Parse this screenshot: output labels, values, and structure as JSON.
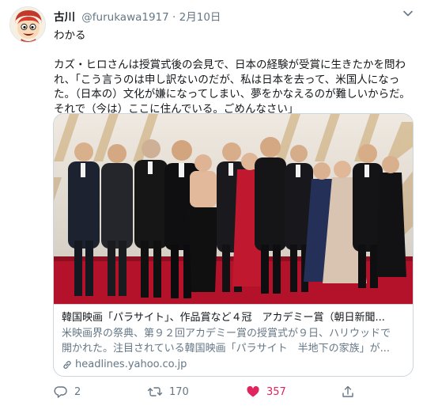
{
  "tweet": {
    "author_name": "古川",
    "author_handle": "@furukawa1917",
    "separator": "·",
    "date": "2月10日",
    "text": "わかる\n\nカズ・ヒロさんは授賞式後の会見で、日本の経験が受賞に生きたかを問われ、「こう言うのは申し訳ないのだが、私は日本を去って、米国人になった。（日本の）文化が嫌になってしまい、夢をかなえるのが難しいからだ。それで（今は）ここに住んでいる。ごめんなさい」"
  },
  "card": {
    "title": "韓国映画「パラサイト」、作品賞など４冠　アカデミー賞（朝日新聞...",
    "description_line1": "米映画界の祭典、第９２回アカデミー賞の授賞式が９日、ハリウッドで",
    "description_line2": "開かれた。注目されている韓国映画「パラサイト　半地下の家族」が...",
    "domain": "headlines.yahoo.co.jp",
    "photo_desc": "group-photo"
  },
  "actions": {
    "reply_count": "2",
    "retweet_count": "170",
    "like_count": "357"
  },
  "colors": {
    "text": "#14171a",
    "secondary": "#657786",
    "like": "#e0245e",
    "border": "#ccd6dd",
    "carpet": "#b3122a"
  },
  "icons": [
    "avatar-character",
    "chevron-down-icon",
    "reply-icon",
    "retweet-icon",
    "heart-icon",
    "share-icon",
    "link-icon"
  ]
}
